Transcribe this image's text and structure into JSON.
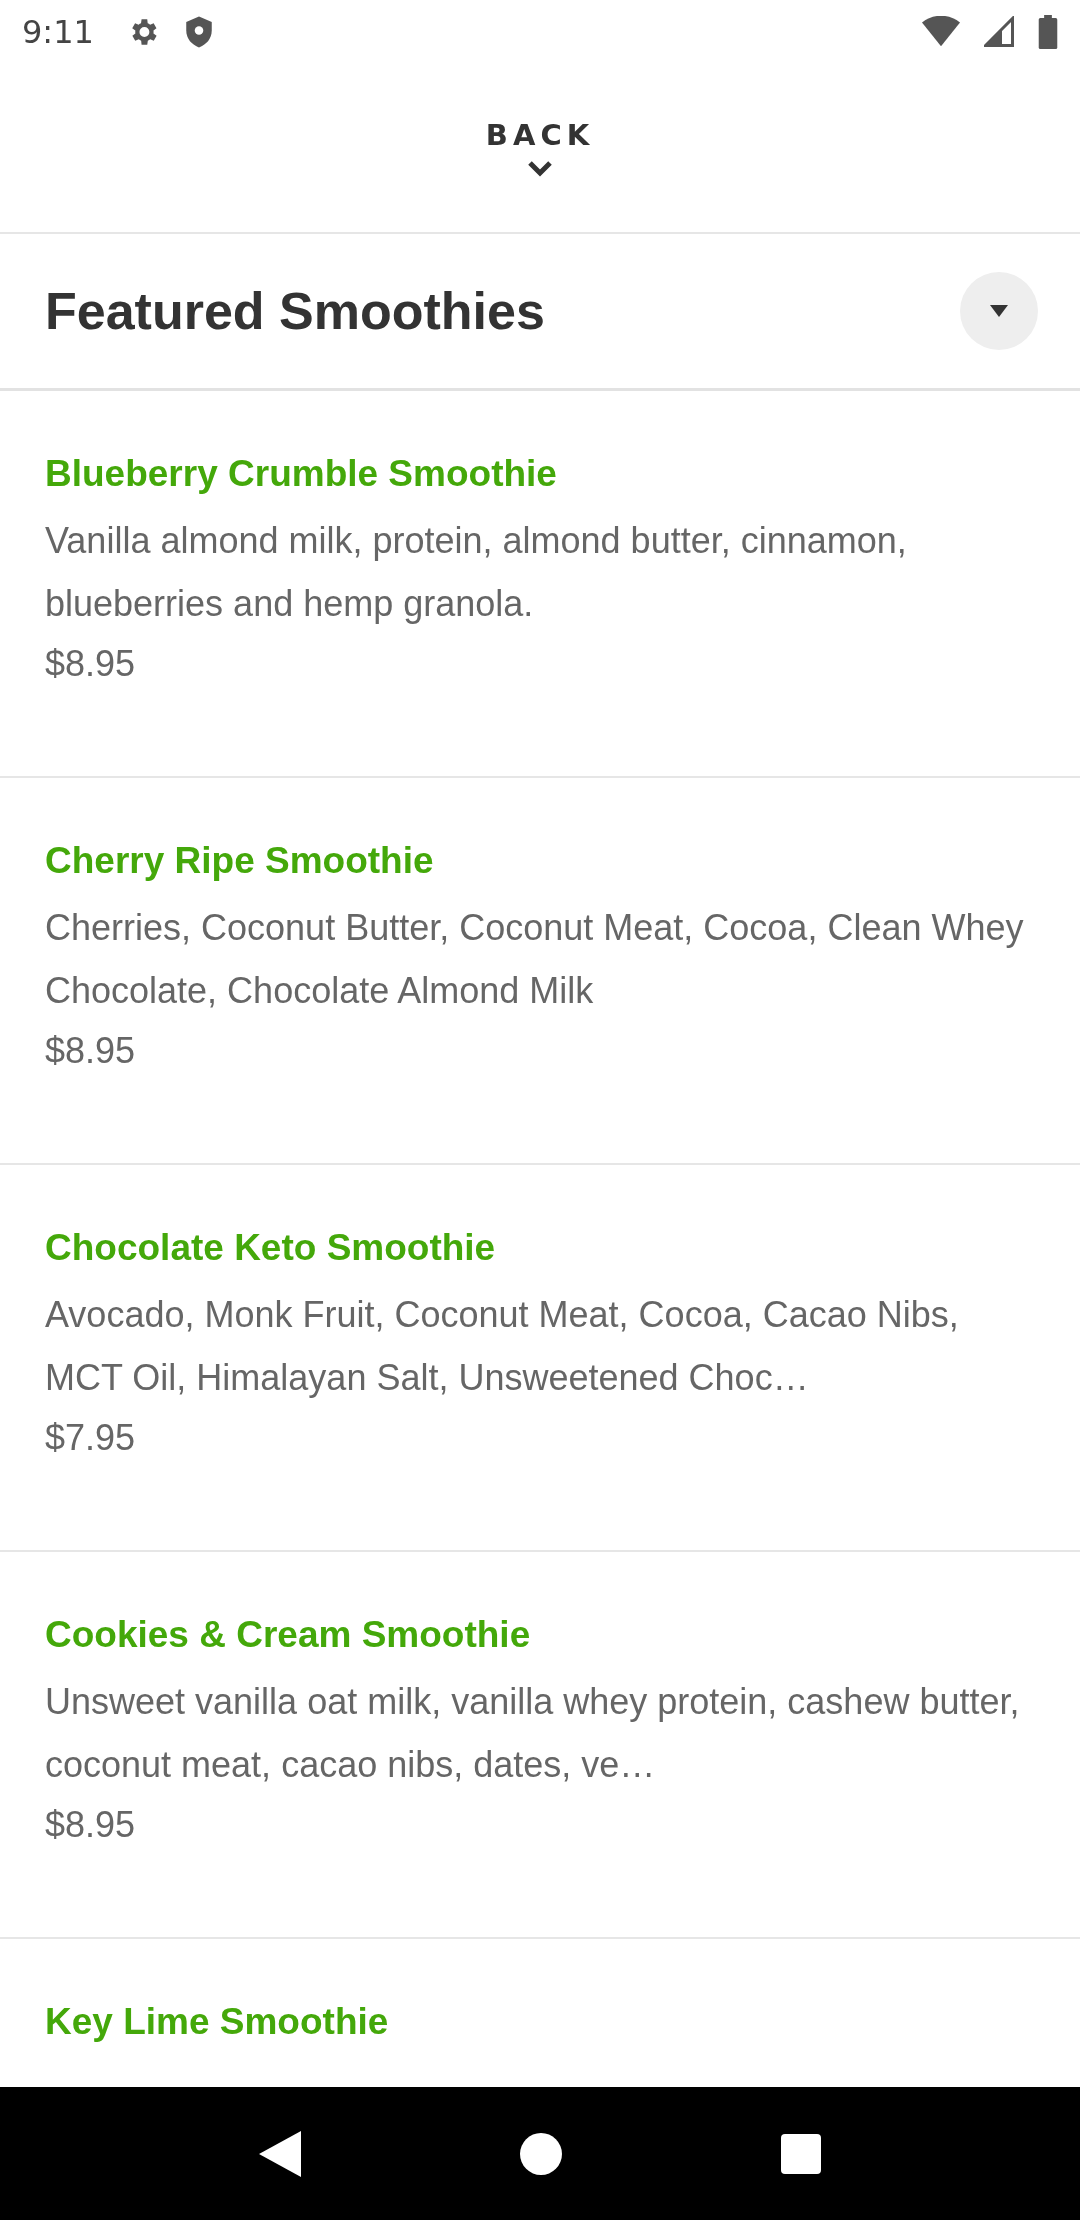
{
  "status_bar": {
    "time": "9:11"
  },
  "back": {
    "label": "BACK"
  },
  "header": {
    "title": "Featured Smoothies"
  },
  "items": [
    {
      "name": "Blueberry Crumble Smoothie",
      "description": "Vanilla almond milk,  protein, almond butter, cinnamon, blueberries and hemp granola.",
      "price": "$8.95"
    },
    {
      "name": "Cherry Ripe Smoothie",
      "description": "Cherries, Coconut Butter, Coconut Meat, Cocoa, Clean Whey Chocolate, Chocolate Almond Milk",
      "price": "$8.95"
    },
    {
      "name": "Chocolate Keto Smoothie",
      "description": "Avocado, Monk Fruit, Coconut Meat, Cocoa, Cacao Nibs, MCT Oil, Himalayan Salt, Unsweetened Choc…",
      "price": "$7.95"
    },
    {
      "name": "Cookies & Cream Smoothie",
      "description": "Unsweet vanilla oat milk, vanilla whey protein, cashew butter, coconut meat, cacao nibs, dates, ve…",
      "price": "$8.95"
    },
    {
      "name": "Key Lime Smoothie"
    }
  ]
}
